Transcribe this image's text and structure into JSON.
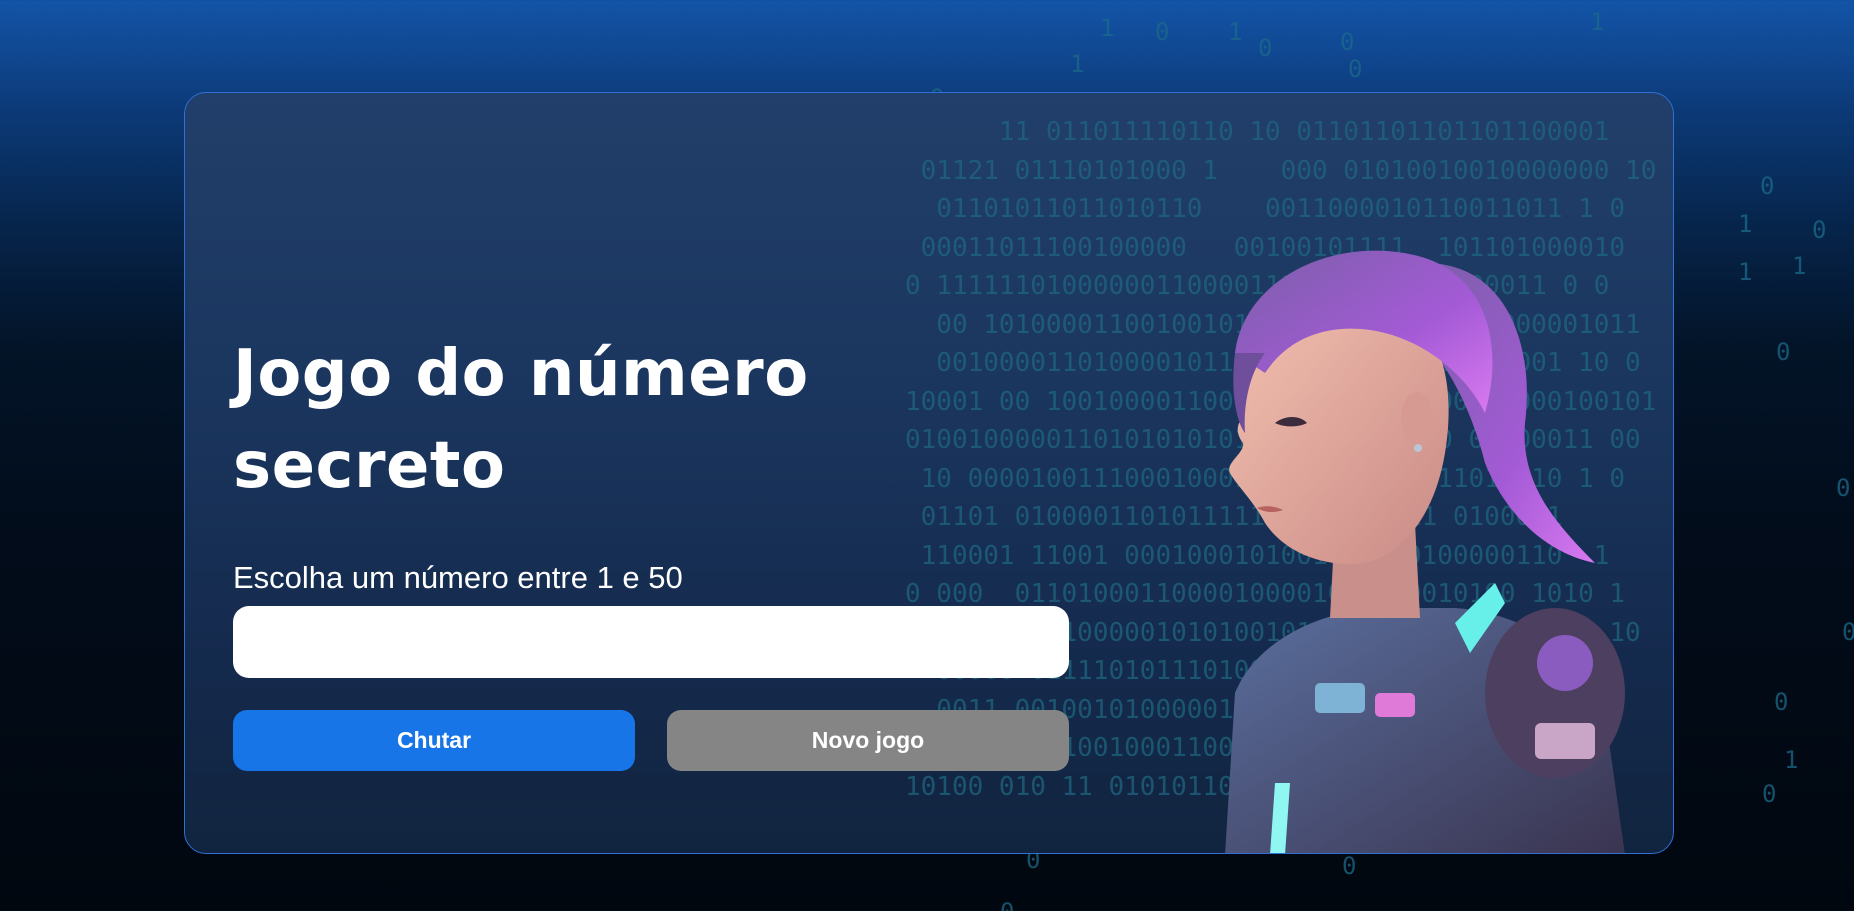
{
  "page": {
    "title_line1": "Jogo do número",
    "title_line2": "secreto",
    "prompt_label": "Escolha um número entre 1 e 50",
    "input_value": "",
    "input_placeholder": ""
  },
  "buttons": {
    "guess_label": "Chutar",
    "new_game_label": "Novo jogo"
  },
  "colors": {
    "primary_button": "#1875e8",
    "secondary_button": "#858585",
    "card_border": "#2f6fd6",
    "background_top": "#1354a8",
    "background_bottom": "#01070f"
  },
  "illustration": {
    "icon": "astronaut-girl-illustration"
  }
}
